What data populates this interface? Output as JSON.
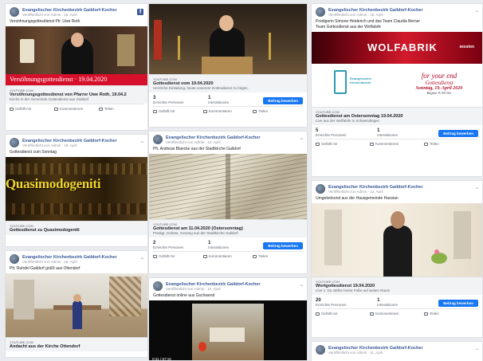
{
  "page": {
    "name": "Evangelischer Kirchenbezirk Gaildorf-Kocher",
    "logo": "f"
  },
  "col1": [
    {
      "name": "Evangelischer Kirchenbezirk Gaildorf-Kocher",
      "meta": "Veröffentlicht von Admin · 19. April",
      "text": "Versöhnungsgottesdienst Pfr. Uwe Roth",
      "caption": "Versöhnungsgottesdienst · 19.04.2020",
      "domain": "YOUTUBE.COM",
      "title": "Versöhnungsgottesdienst von Pfarrer Uwe Roth, 19.04.2",
      "desc": "Kirche in der Gemeinde Gottesdienst aus Gaildorf",
      "actions": [
        "Gefällt mir",
        "Kommentieren",
        "Teilen"
      ]
    },
    {
      "name": "Evangelischer Kirchenbezirk Gaildorf-Kocher",
      "meta": "Veröffentlicht von Admin · 19. April",
      "text": "Gottesdienst zum Sonntag",
      "banner": "Quasimodogeniti",
      "domain": "YOUTUBE.COM",
      "title": "Gottesdienst zu Quasimodogeniti",
      "desc": ""
    },
    {
      "name": "Evangelischer Kirchenbezirk Gaildorf-Kocher",
      "meta": "Veröffentlicht von Admin · 18. April",
      "text": "Pfr. Ruhdel Gaildorf grüßt aus Ottendorf",
      "domain": "YOUTUBE.COM",
      "title": "Andacht aus der Kirche Ottendorf"
    }
  ],
  "col2": [
    {
      "domain": "YOUTUBE.COM",
      "title": "Gottesdienst vom 19.04.2020",
      "desc": "Herzliche Einladung, heute unserem Gottesdienst zu folgen.",
      "stats": [
        {
          "num": "3",
          "label": "Erreichte Personen"
        },
        {
          "num": "1",
          "label": "Interaktionen"
        }
      ],
      "boost": "Beitrag bewerben",
      "actions": [
        "Gefällt mir",
        "Kommentieren",
        "Teilen"
      ]
    },
    {
      "name": "Evangelischer Kirchenbezirk Gaildorf-Kocher",
      "meta": "Veröffentlicht von Admin · 12. April",
      "text": "Pfr. Andreas Blancke aus der Stadtkirche Gaildorf",
      "domain": "YOUTUBE.COM",
      "title": "Gottesdienst am 11.04.2020 (Ostersonntag)",
      "desc": "Predigt, Gebete, Gesang aus der Stadtkirche Gaildorf",
      "stats": [
        {
          "num": "2",
          "label": "Erreichte Personen"
        },
        {
          "num": "1",
          "label": "Interaktionen"
        }
      ],
      "boost": "Beitrag bewerben",
      "actions": [
        "Gefällt mir",
        "Kommentieren",
        "Teilen"
      ]
    },
    {
      "name": "Evangelischer Kirchenbezirk Gaildorf-Kocher",
      "meta": "Veröffentlicht von Admin · 10. April",
      "text": "Gottesdienst online aus Gschwend",
      "overlay": "0:31 / 57:15"
    }
  ],
  "col3": [
    {
      "name": "Evangelischer Kirchenbezirk Gaildorf-Kocher",
      "meta": "Veröffentlicht von Admin · 19. April",
      "text": "Predigerin Simone Heiderich und das Team Claudia Berner",
      "text2": "Team Gottesdienst aus der Wolfabrik",
      "wolf": "WOLFABRIK",
      "wolf_sub": "session",
      "invite": [
        "for your end",
        "Gottesdienst",
        "Sonntag, 19. April 2020",
        "Beginn 9:30 Uhr"
      ],
      "church": [
        "Evangelischer",
        "Kirchenbezirk"
      ],
      "domain": "YOUTUBE.COM",
      "title": "Gottesdienst am Ostersonntag 19.04.2020",
      "desc": "Live aus der Wolfabrik in Schwendingen",
      "stats": [
        {
          "num": "5",
          "label": "Erreichte Personen"
        },
        {
          "num": "1",
          "label": "Interaktionen"
        }
      ],
      "boost": "Beitrag bewerben",
      "actions": [
        "Gefällt mir",
        "Kommentieren",
        "Teilen"
      ]
    },
    {
      "name": "Evangelischer Kirchenbezirk Gaildorf-Kocher",
      "meta": "Veröffentlicht von Admin · 12. April",
      "text": "Umgebetsond aus der Hausgemeinde Hassian",
      "domain": "YOUTUBE.COM",
      "title": "Wortgottesdienst 19.04.2020",
      "desc": "Live 1: Du stellst meine Füße auf weiten Raum",
      "stats": [
        {
          "num": "20",
          "label": "Erreichte Personen"
        },
        {
          "num": "1",
          "label": "Interaktionen"
        }
      ],
      "boost": "Beitrag bewerben",
      "actions": [
        "Gefällt mir",
        "Kommentieren",
        "Teilen"
      ]
    },
    {
      "name": "Evangelischer Kirchenbezirk Gaildorf-Kocher",
      "meta": "Veröffentlicht von Admin · 11. April"
    }
  ]
}
